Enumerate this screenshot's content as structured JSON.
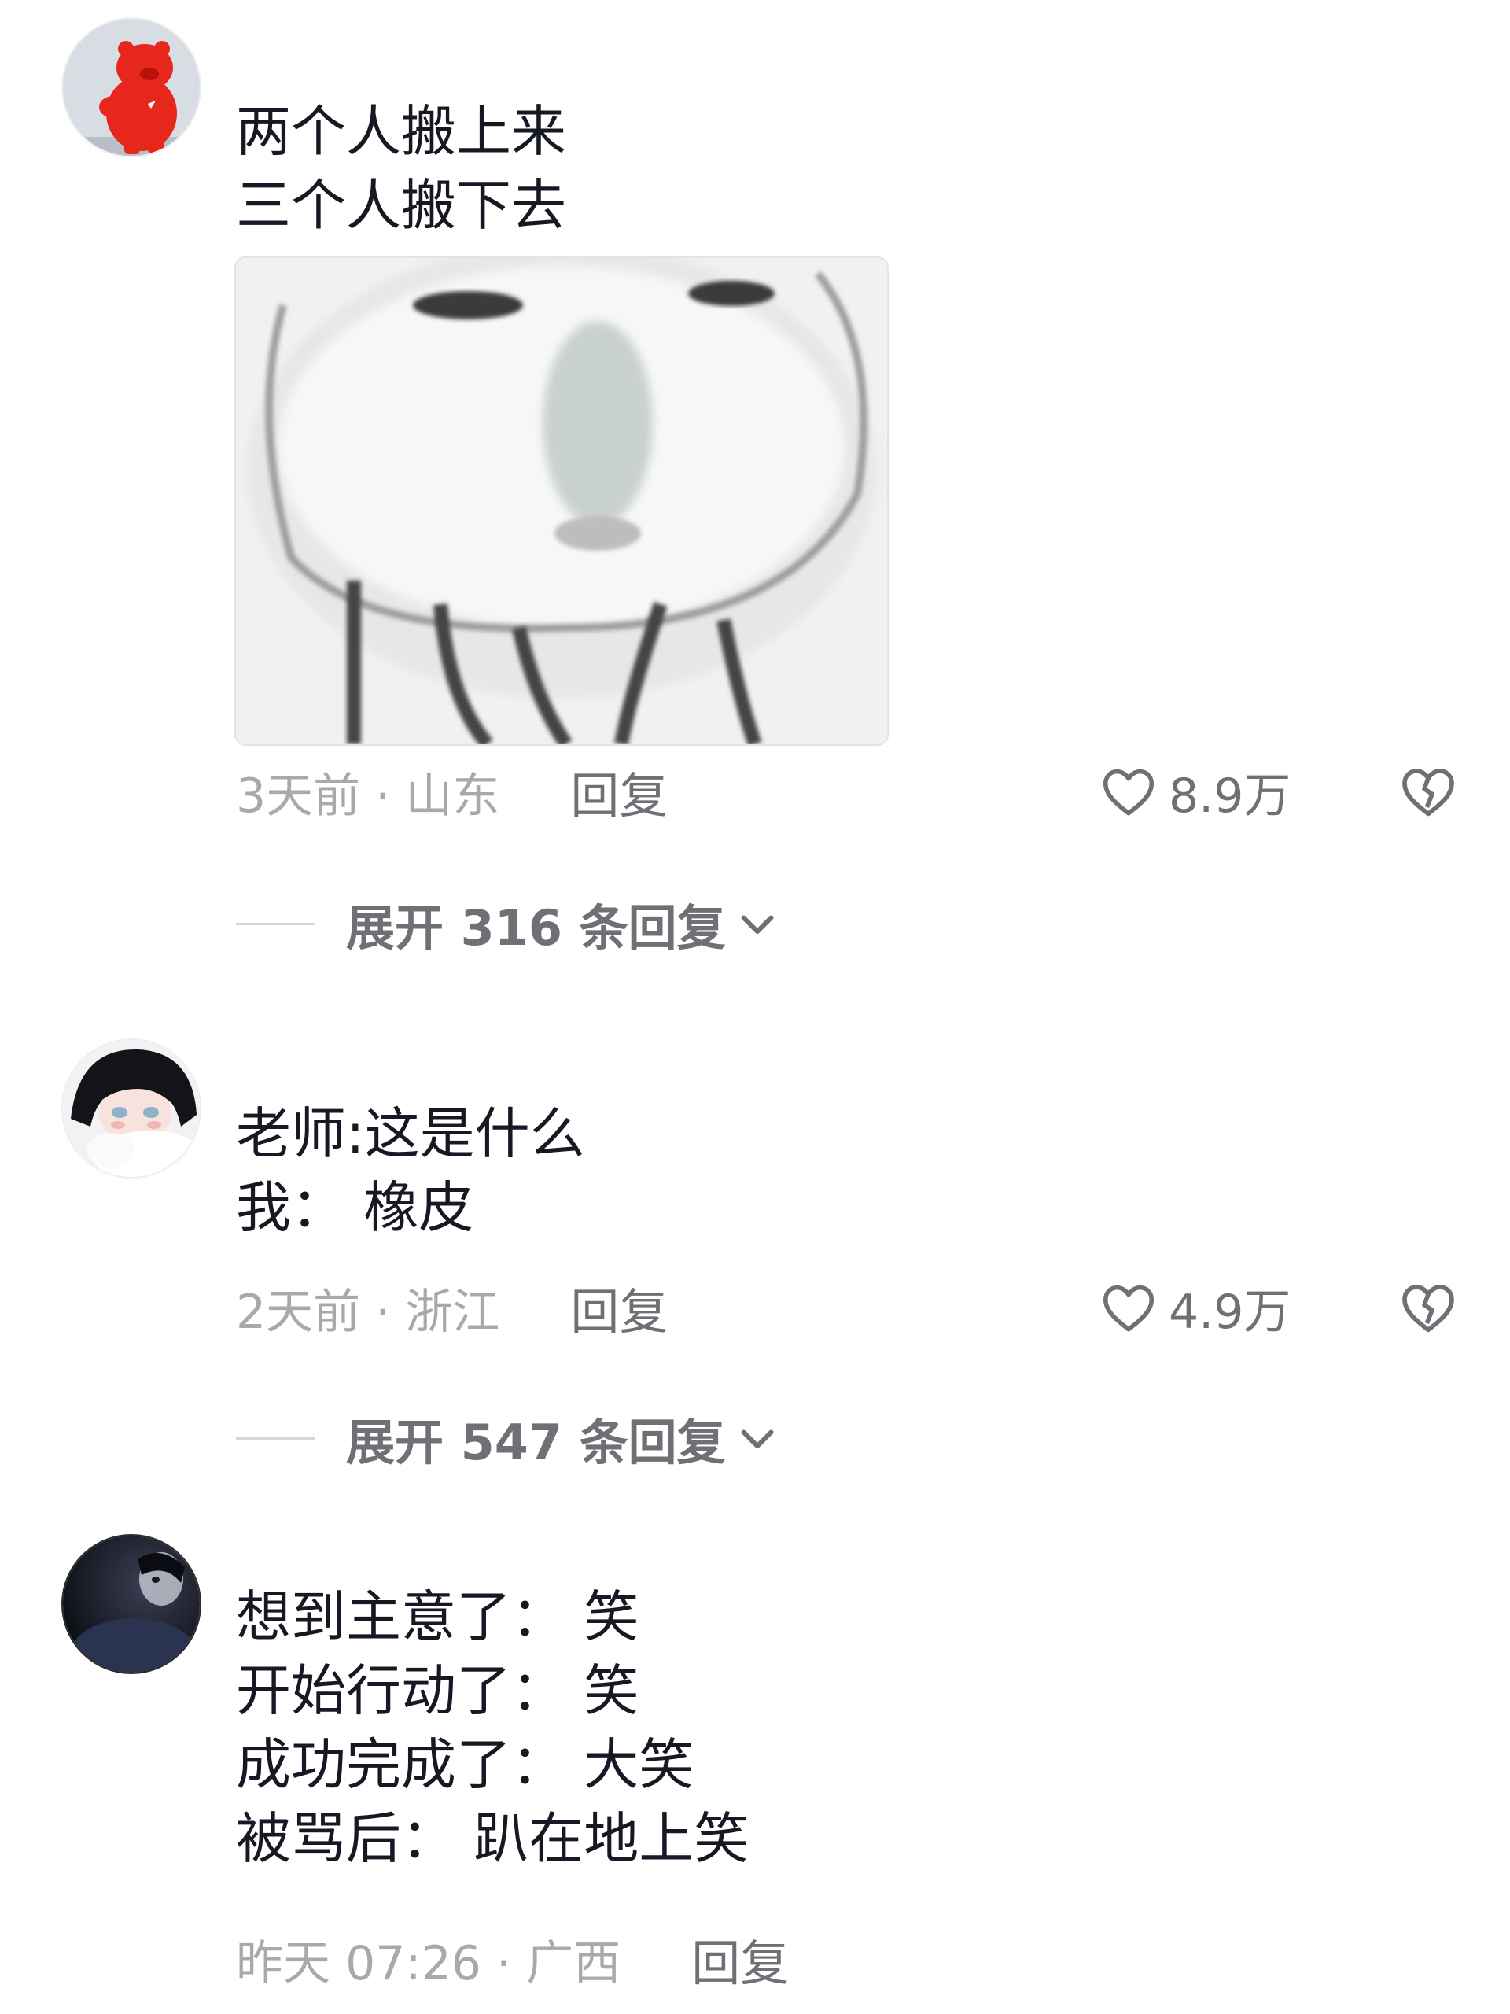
{
  "comments": [
    {
      "lines": [
        "两个人搬上来",
        "三个人搬下去"
      ],
      "time_location": "3天前 · 山东",
      "reply_label": "回复",
      "likes": "8.9万",
      "expand_label": "展开 316 条回复",
      "avatar_icon": "red-pig-avatar",
      "image_icon": "meme-face-sticker"
    },
    {
      "lines": [
        "老师:这是什么",
        "我：  橡皮"
      ],
      "time_location": "2天前 · 浙江",
      "reply_label": "回复",
      "likes": "4.9万",
      "expand_label": "展开 547 条回复",
      "avatar_icon": "anime-girl-avatar"
    },
    {
      "lines": [
        "想到主意了：  笑",
        "开始行动了：  笑",
        "成功完成了：  大笑",
        "被骂后：  趴在地上笑"
      ],
      "time_location": "昨天 07:26 · 广西",
      "reply_label": "回复",
      "avatar_icon": "dark-portrait-avatar"
    }
  ],
  "colors": {
    "text_primary": "#161823",
    "text_secondary": "#a8a9ad",
    "action_gray": "#6f7075",
    "background": "#ffffff"
  },
  "icons": {
    "like": "heart-outline-icon",
    "dislike": "broken-heart-icon",
    "expand": "chevron-down-icon"
  }
}
